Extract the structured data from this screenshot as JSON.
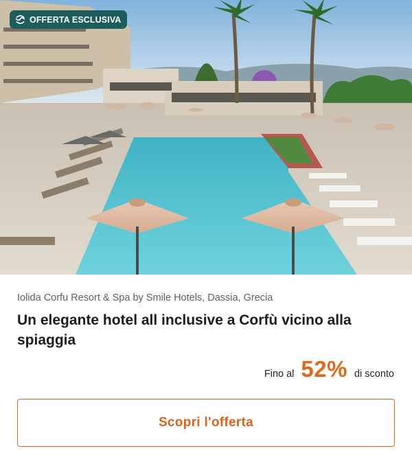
{
  "badge": {
    "label": "OFFERTA ESCLUSIVA",
    "icon": "smile-logo-icon"
  },
  "hero": {
    "image": "resort-pool-photo"
  },
  "hotel": {
    "location": "Iolida Corfu Resort & Spa by Smile Hotels, Dassia, Grecia",
    "title": "Un elegante hotel all inclusive a Corfù vicino alla spiaggia"
  },
  "discount": {
    "prefix": "Fino al",
    "value": "52%",
    "suffix": "di sconto"
  },
  "cta": {
    "label": "Scopri l'offerta"
  },
  "colors": {
    "accent": "#e06a1b",
    "badge": "#1c5d5d"
  }
}
